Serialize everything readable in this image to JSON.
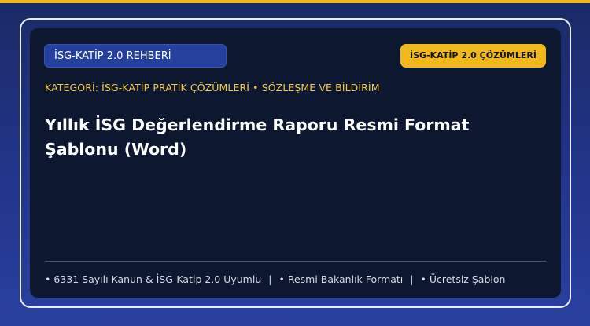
{
  "header": {
    "guide_label": "İSG-KATİP 2.0 REHBERİ",
    "solutions_label": "İSG-KATİP 2.0 ÇÖZÜMLERİ"
  },
  "category": "KATEGORİ: İSG-KATİP PRATİK ÇÖZÜMLERİ • SÖZLEŞME VE BİLDİRİM",
  "title": {
    "line1": "Yıllık İSG Değerlendirme Raporu Resmi Format",
    "line2": "Şablonu (Word)"
  },
  "features": [
    "• 6331 Sayılı Kanun & İSG-Katip 2.0 Uyumlu",
    "• Resmi Bakanlık Formatı",
    "• Ücretsiz Şablon"
  ],
  "separator": "|",
  "colors": {
    "accent": "#f0b81a",
    "card_bg": "#0d1730",
    "pill_bg": "#243f9c",
    "category_text": "#f2c94c"
  }
}
